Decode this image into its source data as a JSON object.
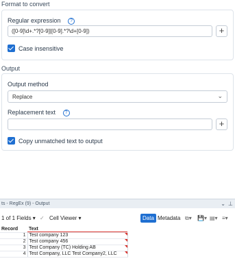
{
  "format_section": {
    "title": "Format to convert",
    "regex_label": "Regular expression",
    "regex_value": "([0-9]\\d+.*?[0-9]|[0-9].*?\\d+[0-9])",
    "case_insensitive_label": "Case insensitive"
  },
  "output_section": {
    "title": "Output",
    "method_label": "Output method",
    "method_value": "Replace",
    "replacement_label": "Replacement text",
    "replacement_value": "",
    "copy_unmatched_label": "Copy unmatched text to output"
  },
  "results": {
    "title": "ts - RegEx (9) - Output",
    "fields_label": "1 of 1 Fields",
    "viewer_label": "Cell Viewer",
    "tab_data": "Data",
    "tab_metadata": "Metadata",
    "columns": [
      "Record",
      "Text"
    ],
    "rows": [
      {
        "record": "1",
        "text": "Test company 123"
      },
      {
        "record": "2",
        "text": "Test company 456"
      },
      {
        "record": "3",
        "text": "Test Company (TC) Holding AB"
      },
      {
        "record": "4",
        "text": "Test Company, LLC  Test Company2, LLC"
      }
    ]
  },
  "icons": {
    "help": "help-circle-icon",
    "plus": "plus-icon",
    "check": "checkmark-icon",
    "chevron": "chevron-down-icon"
  },
  "colors": {
    "accent": "#1f6fd1",
    "error_marker": "#d9302b"
  }
}
